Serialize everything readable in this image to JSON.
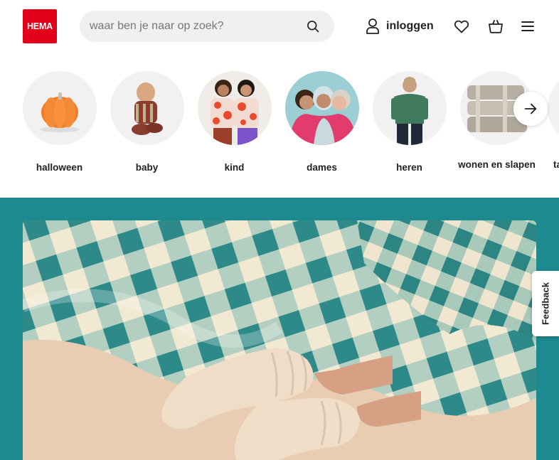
{
  "header": {
    "logo_text": "HEMA",
    "search": {
      "placeholder": "waar ben je naar op zoek?"
    },
    "login_label": "inloggen",
    "icons": [
      "search-icon",
      "user-icon",
      "heart-icon",
      "basket-icon",
      "menu-icon"
    ]
  },
  "categories": [
    {
      "label": "halloween"
    },
    {
      "label": "baby"
    },
    {
      "label": "kind"
    },
    {
      "label": "dames"
    },
    {
      "label": "heren"
    },
    {
      "label": "wonen en slapen"
    },
    {
      "label": "ta"
    }
  ],
  "feedback": {
    "label": "Feedback"
  },
  "colors": {
    "brand_red": "#e3001b",
    "hero_background": "#1d8a8f",
    "search_background": "#f0f0f0"
  }
}
